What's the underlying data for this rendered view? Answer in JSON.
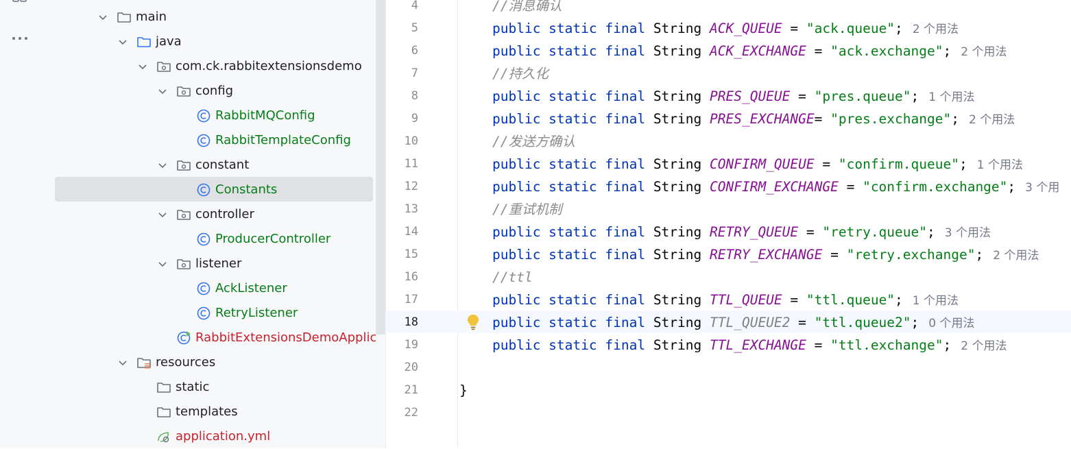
{
  "tree": {
    "items": [
      {
        "label": "main",
        "type": "folder",
        "indent": 0,
        "expanded": true,
        "color": "#1e1f22"
      },
      {
        "label": "java",
        "type": "src-folder",
        "indent": 1,
        "expanded": true,
        "color": "#1e1f22"
      },
      {
        "label": "com.ck.rabbitextensionsdemo",
        "type": "package",
        "indent": 2,
        "expanded": true,
        "color": "#1e1f22"
      },
      {
        "label": "config",
        "type": "package",
        "indent": 3,
        "expanded": true,
        "color": "#1e1f22"
      },
      {
        "label": "RabbitMQConfig",
        "type": "class",
        "indent": 4,
        "expanded": null,
        "color": "#067d17"
      },
      {
        "label": "RabbitTemplateConfig",
        "type": "class",
        "indent": 4,
        "expanded": null,
        "color": "#067d17"
      },
      {
        "label": "constant",
        "type": "package",
        "indent": 3,
        "expanded": true,
        "color": "#1e1f22"
      },
      {
        "label": "Constants",
        "type": "class",
        "indent": 4,
        "expanded": null,
        "color": "#067d17",
        "selected": true
      },
      {
        "label": "controller",
        "type": "package",
        "indent": 3,
        "expanded": true,
        "color": "#1e1f22"
      },
      {
        "label": "ProducerController",
        "type": "class",
        "indent": 4,
        "expanded": null,
        "color": "#067d17"
      },
      {
        "label": "listener",
        "type": "package",
        "indent": 3,
        "expanded": true,
        "color": "#1e1f22"
      },
      {
        "label": "AckListener",
        "type": "class",
        "indent": 4,
        "expanded": null,
        "color": "#067d17"
      },
      {
        "label": "RetryListener",
        "type": "class",
        "indent": 4,
        "expanded": null,
        "color": "#067d17"
      },
      {
        "label": "RabbitExtensionsDemoApplicatio",
        "type": "app-class",
        "indent": 3,
        "expanded": null,
        "color": "#c7222d"
      },
      {
        "label": "resources",
        "type": "res-folder",
        "indent": 1,
        "expanded": true,
        "color": "#1e1f22"
      },
      {
        "label": "static",
        "type": "folder",
        "indent": 2,
        "expanded": null,
        "color": "#1e1f22"
      },
      {
        "label": "templates",
        "type": "folder",
        "indent": 2,
        "expanded": null,
        "color": "#1e1f22"
      },
      {
        "label": "application.yml",
        "type": "yml",
        "indent": 2,
        "expanded": null,
        "color": "#c7222d"
      }
    ]
  },
  "editor": {
    "current_line": 18,
    "lines": [
      {
        "n": "4",
        "parts": [
          [
            "cmt",
            "//消息确认"
          ]
        ]
      },
      {
        "n": "5",
        "parts": [
          [
            "kw",
            "public static final "
          ],
          [
            "ty",
            "String "
          ],
          [
            "cst",
            "ACK_QUEUE"
          ],
          [
            "ty",
            " = "
          ],
          [
            "str",
            "\"ack.queue\""
          ],
          [
            "ty",
            ";"
          ]
        ],
        "hint": "2 个用法"
      },
      {
        "n": "6",
        "parts": [
          [
            "kw",
            "public static final "
          ],
          [
            "ty",
            "String "
          ],
          [
            "cst",
            "ACK_EXCHANGE"
          ],
          [
            "ty",
            " = "
          ],
          [
            "str",
            "\"ack.exchange\""
          ],
          [
            "ty",
            ";"
          ]
        ],
        "hint": "2 个用法"
      },
      {
        "n": "7",
        "parts": [
          [
            "cmt",
            "//持久化"
          ]
        ]
      },
      {
        "n": "8",
        "parts": [
          [
            "kw",
            "public static final "
          ],
          [
            "ty",
            "String "
          ],
          [
            "cst",
            "PRES_QUEUE"
          ],
          [
            "ty",
            " = "
          ],
          [
            "str",
            "\"pres.queue\""
          ],
          [
            "ty",
            ";"
          ]
        ],
        "hint": "1 个用法"
      },
      {
        "n": "9",
        "parts": [
          [
            "kw",
            "public static final "
          ],
          [
            "ty",
            "String "
          ],
          [
            "cst",
            "PRES_EXCHANGE"
          ],
          [
            "ty",
            "= "
          ],
          [
            "str",
            "\"pres.exchange\""
          ],
          [
            "ty",
            ";"
          ]
        ],
        "hint": "2 个用法"
      },
      {
        "n": "10",
        "parts": [
          [
            "cmt",
            "//发送方确认"
          ]
        ]
      },
      {
        "n": "11",
        "parts": [
          [
            "kw",
            "public static final "
          ],
          [
            "ty",
            "String "
          ],
          [
            "cst",
            "CONFIRM_QUEUE"
          ],
          [
            "ty",
            " = "
          ],
          [
            "str",
            "\"confirm.queue\""
          ],
          [
            "ty",
            ";"
          ]
        ],
        "hint": "1 个用法"
      },
      {
        "n": "12",
        "parts": [
          [
            "kw",
            "public static final "
          ],
          [
            "ty",
            "String "
          ],
          [
            "cst",
            "CONFIRM_EXCHANGE"
          ],
          [
            "ty",
            " = "
          ],
          [
            "str",
            "\"confirm.exchange\""
          ],
          [
            "ty",
            ";"
          ]
        ],
        "hint": "3 个用"
      },
      {
        "n": "13",
        "parts": [
          [
            "cmt",
            "//重试机制"
          ]
        ]
      },
      {
        "n": "14",
        "parts": [
          [
            "kw",
            "public static final "
          ],
          [
            "ty",
            "String "
          ],
          [
            "cst",
            "RETRY_QUEUE"
          ],
          [
            "ty",
            " = "
          ],
          [
            "str",
            "\"retry.queue\""
          ],
          [
            "ty",
            ";"
          ]
        ],
        "hint": "3 个用法"
      },
      {
        "n": "15",
        "parts": [
          [
            "kw",
            "public static final "
          ],
          [
            "ty",
            "String "
          ],
          [
            "cst",
            "RETRY_EXCHANGE"
          ],
          [
            "ty",
            " = "
          ],
          [
            "str",
            "\"retry.exchange\""
          ],
          [
            "ty",
            ";"
          ]
        ],
        "hint": "2 个用法"
      },
      {
        "n": "16",
        "parts": [
          [
            "cmt",
            "//ttl"
          ]
        ]
      },
      {
        "n": "17",
        "parts": [
          [
            "kw",
            "public static final "
          ],
          [
            "ty",
            "String "
          ],
          [
            "cst",
            "TTL_QUEUE"
          ],
          [
            "ty",
            " = "
          ],
          [
            "str",
            "\"ttl.queue\""
          ],
          [
            "ty",
            ";"
          ]
        ],
        "hint": "1 个用法"
      },
      {
        "n": "18",
        "parts": [
          [
            "kw",
            "public static final "
          ],
          [
            "ty",
            "String "
          ],
          [
            "cst-un",
            "TTL_QUEUE2"
          ],
          [
            "ty",
            " = "
          ],
          [
            "str",
            "\"ttl.queue2\""
          ],
          [
            "ty",
            ";"
          ]
        ],
        "hint": "0 个用法"
      },
      {
        "n": "19",
        "parts": [
          [
            "kw",
            "public static final "
          ],
          [
            "ty",
            "String "
          ],
          [
            "cst",
            "TTL_EXCHANGE"
          ],
          [
            "ty",
            " = "
          ],
          [
            "str",
            "\"ttl.exchange\""
          ],
          [
            "ty",
            ";"
          ]
        ],
        "hint": "2 个用法"
      },
      {
        "n": "20",
        "parts": []
      },
      {
        "n": "21",
        "parts": [
          [
            "ty",
            "}"
          ]
        ],
        "outdent": true
      },
      {
        "n": "22",
        "parts": []
      }
    ]
  },
  "colors": {
    "keyword": "#0033b3",
    "constant": "#871094",
    "string": "#067d17",
    "comment": "#8c8c8c",
    "hint": "#767a8a"
  }
}
